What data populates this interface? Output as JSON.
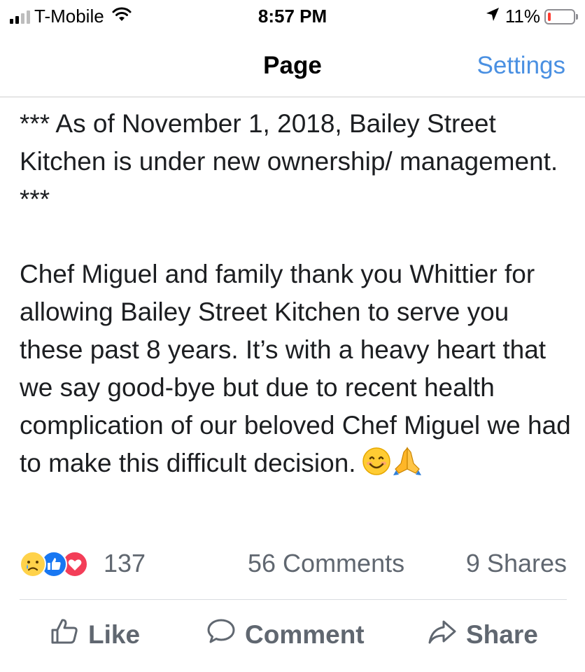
{
  "status_bar": {
    "carrier": "T-Mobile",
    "time": "8:57 PM",
    "battery_percent": "11%",
    "battery_level": 0.11,
    "signal_bars": 2,
    "colors": {
      "battery_low": "#ff3b30"
    }
  },
  "nav": {
    "title": "Page",
    "settings_label": "Settings",
    "colors": {
      "link": "#4a90e2"
    }
  },
  "post": {
    "paragraphs": [
      "*** As of November 1, 2018, Bailey Street Kitchen is under new ownership/ management. ***",
      "Chef Miguel and family thank you Whittier for allowing Bailey Street Kitchen to serve you these past 8 years. It’s with a heavy heart that we say good-bye but due to recent health complication of our beloved Chef Miguel we had to make this difficult decision."
    ],
    "emojis": [
      "smiling-face-emoji",
      "folded-hands-emoji"
    ]
  },
  "stats": {
    "reaction_icons": [
      "sad-reaction-icon",
      "like-reaction-icon",
      "love-reaction-icon"
    ],
    "reaction_count": "137",
    "comments": "56 Comments",
    "shares": "9 Shares"
  },
  "actions": {
    "like_label": "Like",
    "comment_label": "Comment",
    "share_label": "Share",
    "icons": [
      "thumbs-up-icon",
      "comment-bubble-icon",
      "share-arrow-icon"
    ]
  }
}
